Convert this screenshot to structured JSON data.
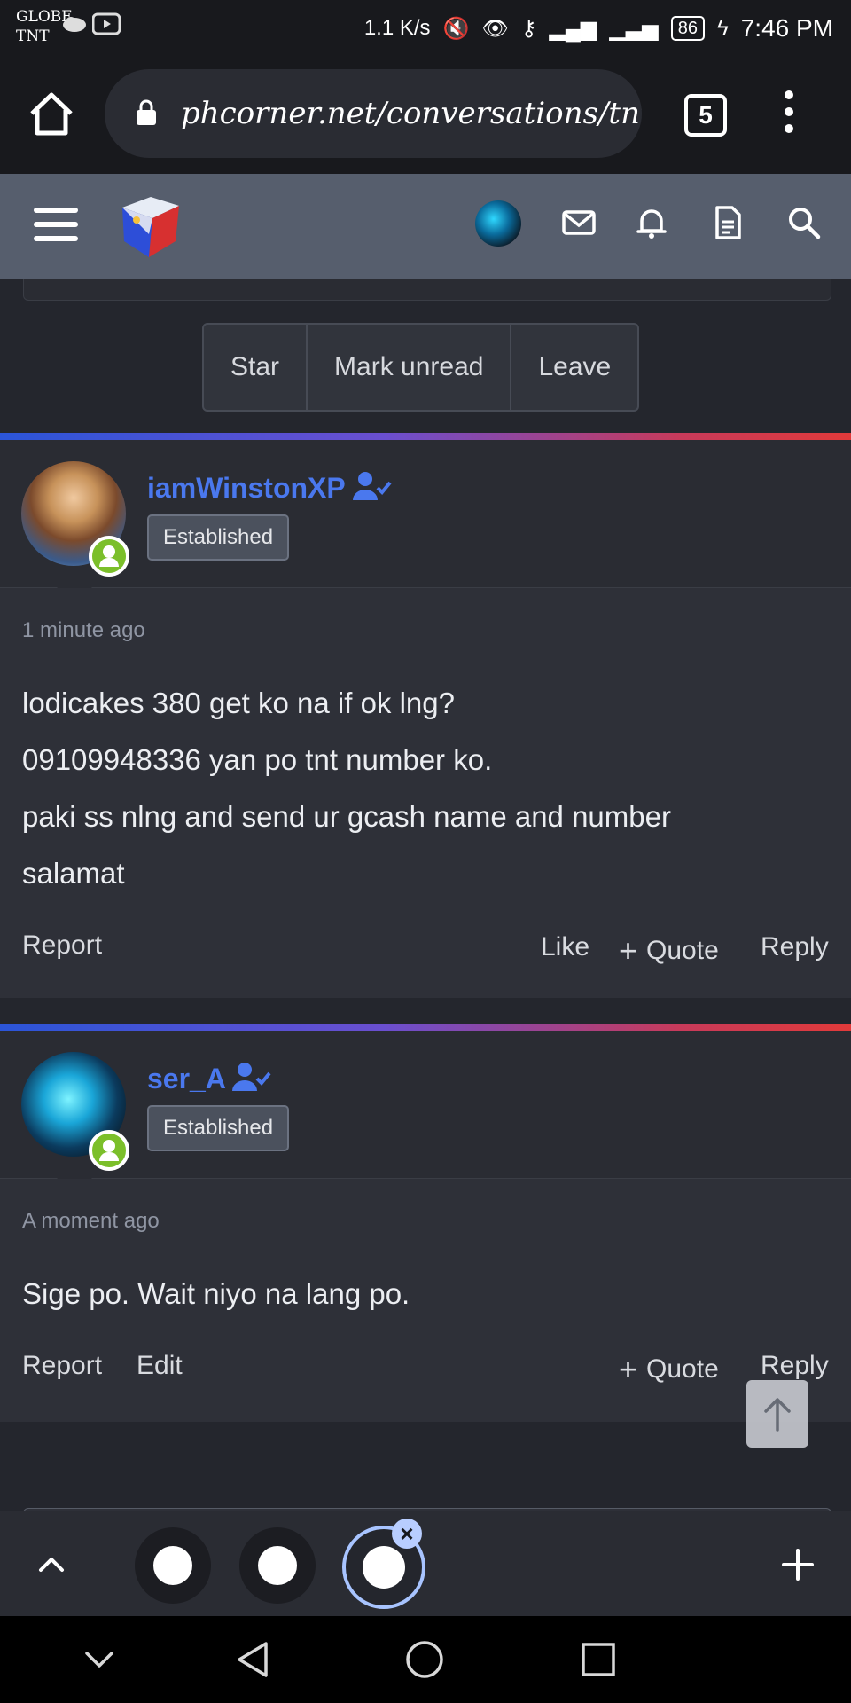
{
  "status_bar": {
    "carrier_line1": "GLOBE",
    "carrier_line2": "TNT",
    "speed": "1.1 K/s",
    "battery": "86",
    "time": "7:46 PM"
  },
  "browser": {
    "url": "phcorner.net/conversations/tnt-lo",
    "tab_count": "5"
  },
  "conversation_controls": {
    "star": "Star",
    "mark_unread": "Mark unread",
    "leave": "Leave"
  },
  "messages": [
    {
      "username": "iamWinstonXP",
      "badge": "Established",
      "timestamp": "1 minute ago",
      "lines": [
        "lodicakes 380 get ko na if ok lng?",
        "09109948336 yan po tnt number ko.",
        "paki ss nlng and send ur gcash name and number",
        "salamat"
      ],
      "actions": {
        "report": "Report",
        "like": "Like",
        "quote": "Quote",
        "reply": "Reply"
      }
    },
    {
      "username": "ser_A",
      "badge": "Established",
      "timestamp": "A moment ago",
      "lines": [
        "Sige po. Wait niyo na lang po."
      ],
      "actions": {
        "report": "Report",
        "edit": "Edit",
        "quote": "Quote",
        "reply": "Reply"
      }
    }
  ],
  "colors": {
    "accent_username": "#4a78ee",
    "header_bg": "#565e6d",
    "online_green": "#7bbf2a"
  }
}
